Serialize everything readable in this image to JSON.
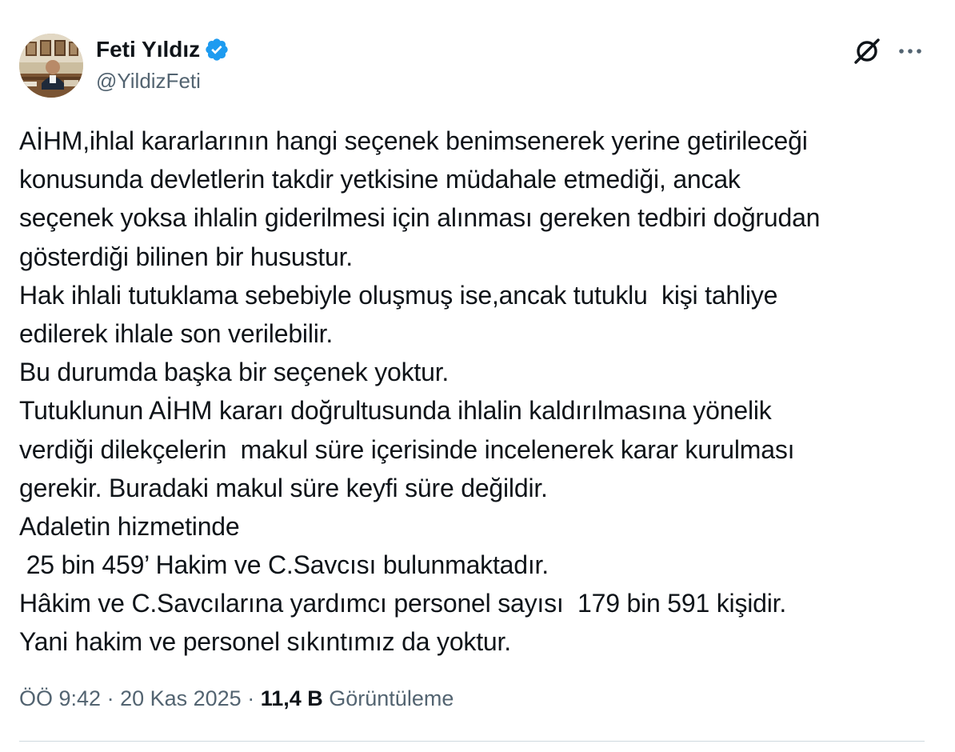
{
  "author": {
    "display_name": "Feti Yıldız",
    "handle": "@YildizFeti",
    "verified": true,
    "verified_color": "#1d9bf0"
  },
  "header_actions": {
    "grok_icon": "grok-icon",
    "more_icon": "more-icon",
    "more_label": "•••"
  },
  "tweet": {
    "lines": [
      "AİHM,ihlal kararlarının hangi seçenek benimsenerek yerine getirileceği",
      "konusunda devletlerin takdir yetkisine müdahale etmediği, ancak",
      "seçenek yoksa ihlalin giderilmesi için alınması gereken tedbiri doğrudan",
      "gösterdiği bilinen bir husustur.",
      "Hak ihlali tutuklama sebebiyle oluşmuş ise,ancak tutuklu  kişi tahliye",
      "edilerek ihlale son verilebilir.",
      "Bu durumda başka bir seçenek yoktur.",
      "Tutuklunun AİHM kararı doğrultusunda ihlalin kaldırılmasına yönelik",
      "verdiği dilekçelerin  makul süre içerisinde incelenerek karar kurulması",
      "gerekir. Buradaki makul süre keyfi süre değildir.",
      "Adaletin hizmetinde",
      " 25 bin 459’ Hakim ve C.Savcısı bulunmaktadır.",
      "Hâkim ve C.Savcılarına yardımcı personel sayısı  179 bin 591 kişidir.",
      "Yani hakim ve personel sıkıntımız da yoktur."
    ]
  },
  "meta": {
    "time": "ÖÖ 9:42",
    "separator": " · ",
    "date": "20 Kas 2025",
    "separator2": " · ",
    "views_count": "11,4 B",
    "views_label": "Görüntüleme"
  },
  "colors": {
    "text": "#0f1419",
    "secondary": "#536471",
    "divider": "#cfd9de"
  }
}
